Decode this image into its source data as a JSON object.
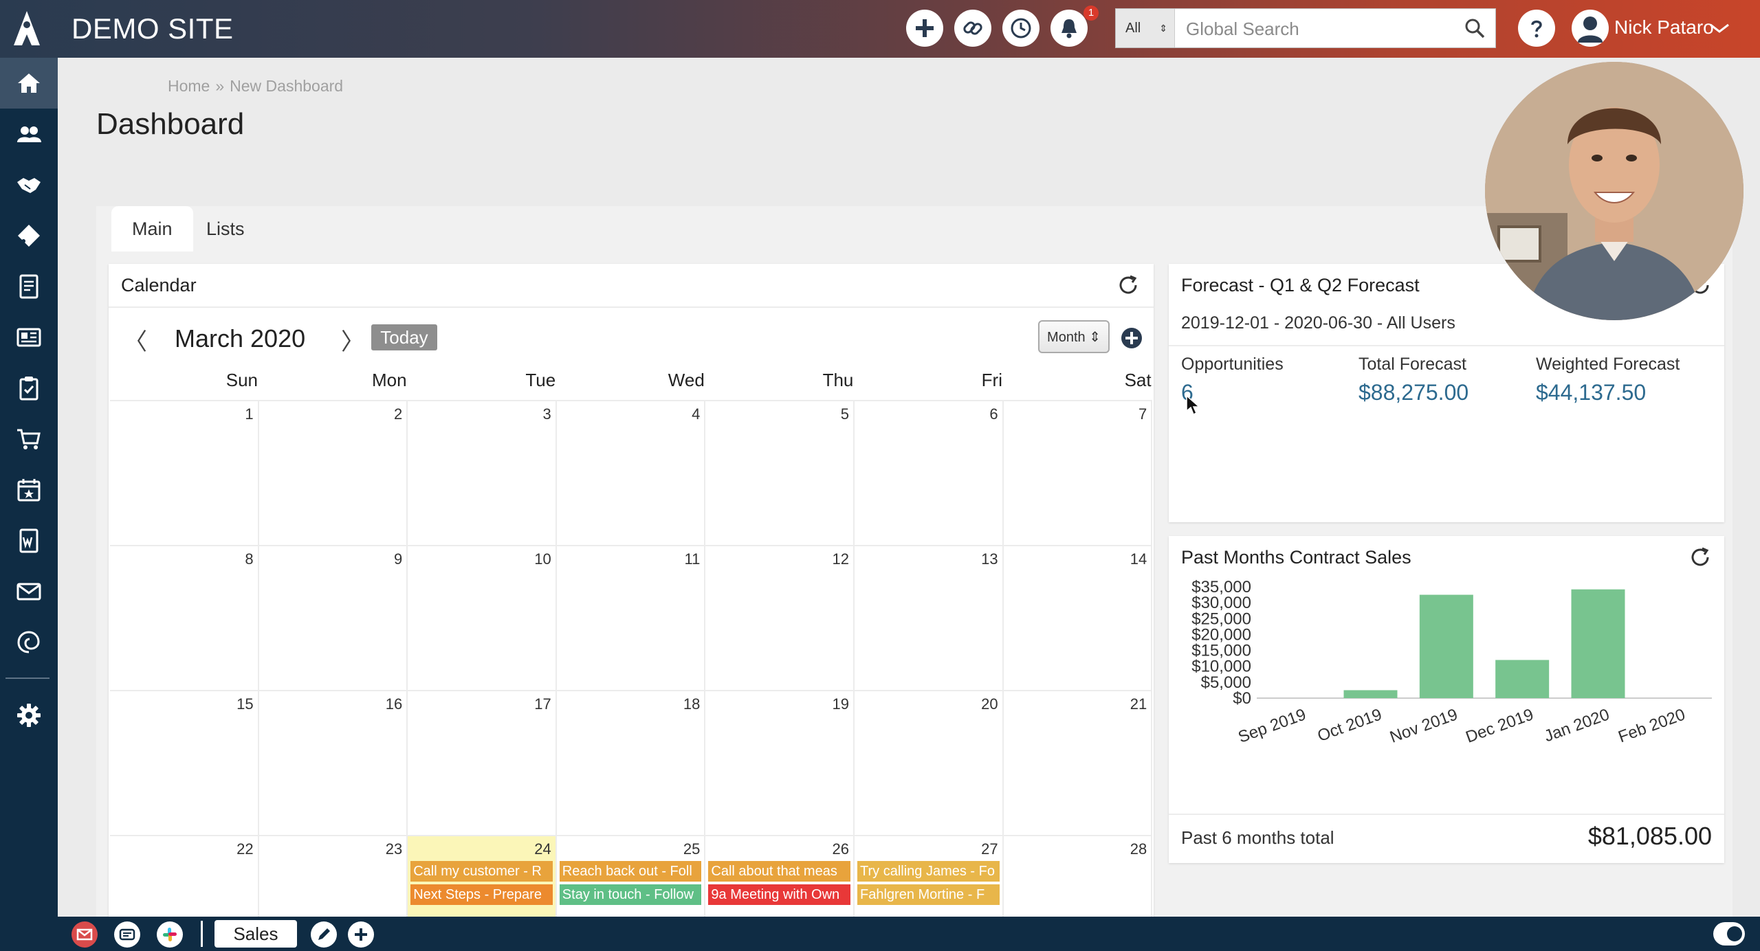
{
  "topbar": {
    "site_title": "DEMO SITE",
    "notification_count": "1",
    "search": {
      "scope": "All",
      "placeholder": "Global Search"
    },
    "user_name": "Nick Pataro"
  },
  "breadcrumb": {
    "home": "Home",
    "separator": "»",
    "current": "New Dashboard"
  },
  "page_title": "Dashboard",
  "tabs": [
    {
      "label": "Main"
    },
    {
      "label": "Lists"
    }
  ],
  "calendar": {
    "title": "Calendar",
    "month_label": "March 2020",
    "prev": "〈",
    "next": "〉",
    "today_label": "Today",
    "view_label": "Month ⇕",
    "weekdays": [
      "Sun",
      "Mon",
      "Tue",
      "Wed",
      "Thu",
      "Fri",
      "Sat"
    ],
    "days": [
      "1",
      "2",
      "3",
      "4",
      "5",
      "6",
      "7",
      "8",
      "9",
      "10",
      "11",
      "12",
      "13",
      "14",
      "15",
      "16",
      "17",
      "18",
      "19",
      "20",
      "21",
      "22",
      "23",
      "24",
      "25",
      "26",
      "27",
      "28"
    ],
    "events": [
      {
        "day": "24",
        "text": "Call my customer - R",
        "color": "#e8a33c"
      },
      {
        "day": "24",
        "text": "Next Steps - Prepare",
        "color": "#ec8a2e"
      },
      {
        "day": "25",
        "text": "Reach back out - Foll",
        "color": "#e8a33c"
      },
      {
        "day": "25",
        "text": "Stay in touch - Follow",
        "color": "#5fbf86"
      },
      {
        "day": "26",
        "text": "Call about that meas",
        "color": "#e8a33c"
      },
      {
        "day": "26",
        "text": "9a Meeting with Own",
        "color": "#e83838"
      },
      {
        "day": "27",
        "text": "Try calling James - Fo",
        "color": "#e8b64a"
      },
      {
        "day": "27",
        "text": "Fahlgren Mortine - F",
        "color": "#e8b64a"
      }
    ]
  },
  "forecast": {
    "title": "Forecast - Q1 & Q2 Forecast",
    "range": "2019-12-01 - 2020-06-30 - All Users",
    "opportunities_label": "Opportunities",
    "opportunities_value": "6",
    "total_label": "Total Forecast",
    "total_value": "$88,275.00",
    "weighted_label": "Weighted Forecast",
    "weighted_value": "$44,137.50"
  },
  "contract_sales": {
    "title": "Past Months Contract Sales",
    "total_label": "Past 6 months total",
    "total_value": "$81,085.00"
  },
  "chart_data": {
    "type": "bar",
    "categories": [
      "Sep 2019",
      "Oct 2019",
      "Nov 2019",
      "Dec 2019",
      "Jan 2020",
      "Feb 2020"
    ],
    "values": [
      0,
      2500,
      32500,
      12000,
      34200,
      0
    ],
    "yticks": [
      "$0",
      "$5,000",
      "$10,000",
      "$15,000",
      "$20,000",
      "$25,000",
      "$30,000",
      "$35,000"
    ],
    "ylim": [
      0,
      35000
    ],
    "bar_color": "#78c48f",
    "grid": false
  },
  "colors": {
    "sidebar": "#0f2c44",
    "sidebar_active": "#3c5167",
    "value_blue": "#2d6a8f",
    "today": "#fbf6b8"
  },
  "bottombar": {
    "sales_label": "Sales"
  }
}
